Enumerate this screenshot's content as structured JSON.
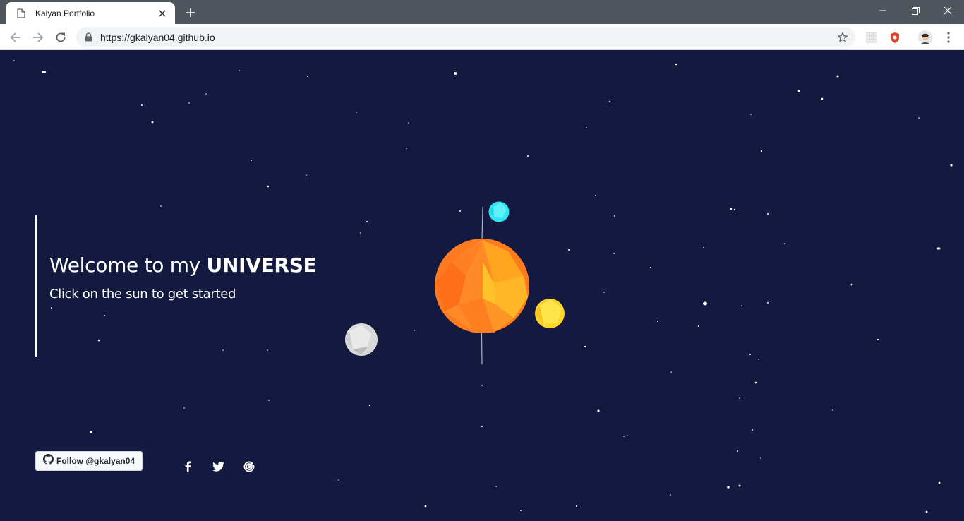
{
  "browser": {
    "tab_title": "Kalyan Portfolio",
    "url": "https://gkalyan04.github.io"
  },
  "hero": {
    "welcome_prefix": "Welcome to my ",
    "welcome_emphasis": "UNIVERSE",
    "subtitle": "Click on the sun to get started"
  },
  "footer": {
    "follow_label": "Follow @gkalyan04",
    "social_icons": [
      "facebook-icon",
      "twitter-icon",
      "google-icon"
    ]
  },
  "colors": {
    "background": "#141a3f",
    "sun": "#ff7a1f",
    "cyan_planet": "#2ee6f2",
    "yellow_planet": "#ffd42a",
    "moon": "#d9d9d9"
  }
}
